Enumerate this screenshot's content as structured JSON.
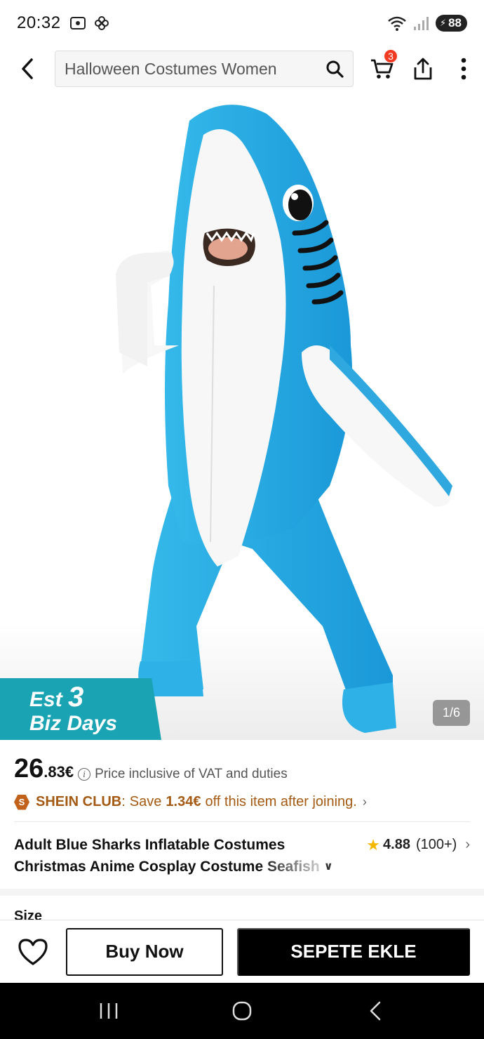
{
  "status_bar": {
    "time": "20:32",
    "battery": "88",
    "left_icons": [
      "screenshot-icon",
      "pinwheel-icon"
    ],
    "right_icons": [
      "wifi-icon",
      "signal-icon",
      "battery-icon"
    ]
  },
  "nav": {
    "search_value": "Halloween Costumes Women",
    "cart_count": "3",
    "icons": [
      "back-icon",
      "search-icon",
      "cart-icon",
      "share-icon",
      "more-vertical-icon"
    ]
  },
  "hero": {
    "est_prefix": "Est",
    "est_number": "3",
    "est_suffix": "Biz Days",
    "page_indicator": "1/6",
    "badge_color": "#1aa3b3"
  },
  "price": {
    "main": "26",
    "cents": ".83€",
    "note": "Price inclusive of VAT and duties"
  },
  "club": {
    "name": "SHEIN CLUB",
    "colon": ":",
    "save_prefix": "Save",
    "amount": "1.34€",
    "suffix": "off this item after joining.",
    "badge_letter": "S",
    "color": "#a45a13"
  },
  "product": {
    "title_line1": "Adult Blue Sharks Inflatable Costumes",
    "title_line2": "Christmas Anime Cosplay Costume Seafish",
    "rating": "4.88",
    "reviews": "(100+)"
  },
  "size_label": "Size",
  "actions": {
    "buy_now": "Buy Now",
    "add_to_cart": "SEPETE EKLE"
  }
}
